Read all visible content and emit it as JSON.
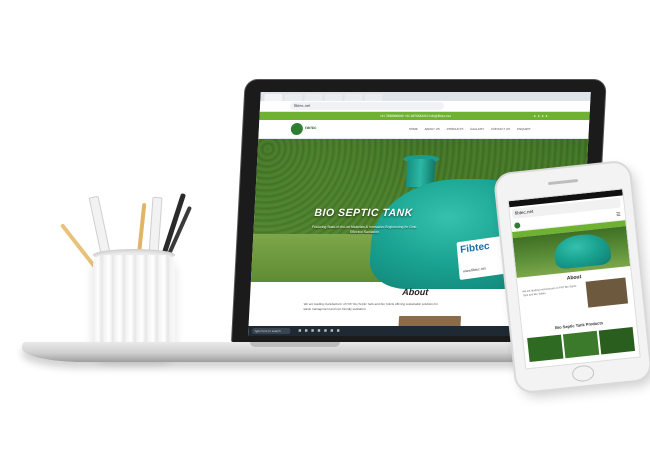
{
  "browser": {
    "url": "fibtec.net"
  },
  "site": {
    "top_strip": "+91 7838800000  +91 9876543210  info@fibtec.net",
    "logo_text": "FIBTEC",
    "menu": [
      "HOME",
      "ABOUT US",
      "PRODUCTS",
      "GALLERY",
      "CONTACT US",
      "ENQUIRY"
    ]
  },
  "hero": {
    "title": "BIO SEPTIC TANK",
    "subtitle": "Featuring State-of-the-art Materials & Innovative Engineering for Cost-Effective Sanitation"
  },
  "tank": {
    "brand": "Fibtec",
    "site": "www.fibtec.net"
  },
  "about": {
    "title": "About",
    "text": "We are leading manufacturer of FRP Bio Septic Tank and Bio Toilets offering sustainable solutions for waste management and eco-friendly sanitation."
  },
  "taskbar": {
    "search": "Type here to search"
  },
  "phone": {
    "url": "fibtec.net",
    "about_title": "About",
    "about_text": "We are leading manufacturer of FRP Bio Septic Tank and Bio Toilets.",
    "cta": "Bio Septic Tank Products"
  },
  "colors": {
    "brand_green": "#6fb232",
    "tank_teal": "#1aa392",
    "laptop_frame": "#1b1b1b"
  }
}
